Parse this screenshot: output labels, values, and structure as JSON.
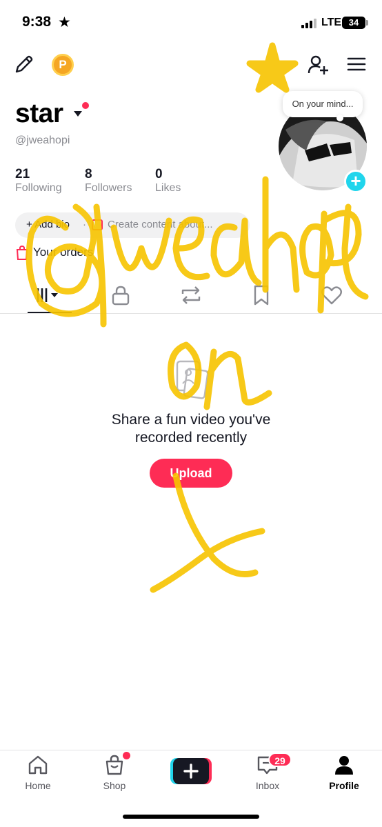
{
  "status_bar": {
    "time": "9:38",
    "network": "LTE",
    "battery": "34"
  },
  "profile": {
    "name": "star",
    "handle": "@jweahopi",
    "stats": [
      {
        "value": "21",
        "label": "Following"
      },
      {
        "value": "8",
        "label": "Followers"
      },
      {
        "value": "0",
        "label": "Likes"
      }
    ],
    "thought_bubble": "On your mind...",
    "add_bio": "+ Add bio",
    "separator": "·",
    "create_content": "Create content about...",
    "orders": "Your orders"
  },
  "tabs": [
    "videos",
    "private",
    "reposts",
    "favorites",
    "liked"
  ],
  "empty_state": {
    "title_line1": "Share a fun video you've",
    "title_line2": "recorded recently",
    "upload_label": "Upload"
  },
  "overlay_text": "@jweahopi on X",
  "bottom_nav": {
    "home": "Home",
    "shop": "Shop",
    "inbox": "Inbox",
    "inbox_badge": "29",
    "profile": "Profile"
  },
  "colors": {
    "accent": "#fe2c55",
    "cyan": "#20d5ec",
    "scribble": "#f7c400"
  }
}
